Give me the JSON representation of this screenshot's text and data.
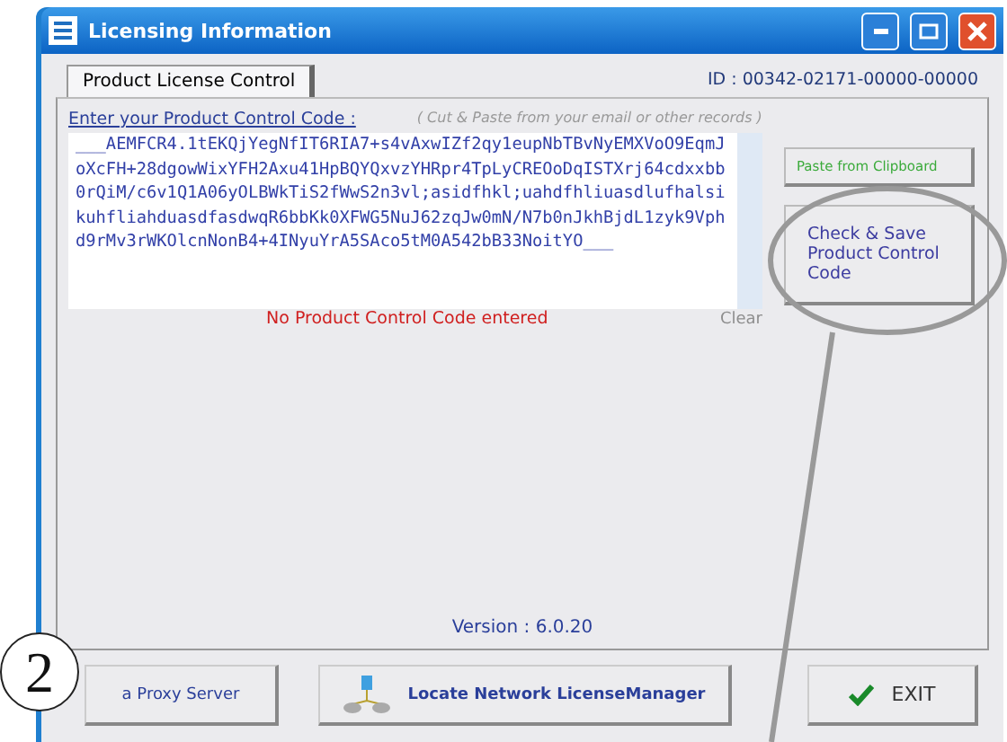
{
  "window": {
    "title": "Licensing Information"
  },
  "tabs": [
    {
      "label": "Product License Control",
      "selected": true
    }
  ],
  "id_label": "ID : 00342-02171-00000-00000",
  "code_label": "Enter your Product Control Code :",
  "code_hint": "( Cut & Paste from your email or other records )",
  "code_value": "___AEMFCR4.1tEKQjYegNfIT6RIA7+s4vAxwIZf2qy1eupNbTBvNyEMXVoO9EqmJoXcFH+28dgowWixYFH2Axu41HpBQYQxvzYHRpr4TpLyCREOoDqISTXrj64cdxxbb0rQiM/c6v1Q1A06yOLBWkTiS2fWwS2n3vl;asidfhkl;uahdfhliuasdlufhalsikuhfliahduasdfasdwqR6bbKk0XFWG5NuJ62zqJw0mN/N7b0nJkhBjdL1zyk9Vphd9rMv3rWKOlcnNonB4+4INyuYrA5SAco5tM0A542bB33NoitYO___",
  "status_message": "No Product Control Code entered",
  "clear_label": "Clear",
  "side_buttons": [
    {
      "label": "Paste from Clipboard",
      "kind": "paste"
    },
    {
      "label": "Check & Save Product Control Code",
      "kind": "check"
    }
  ],
  "version": "Version : 6.0.20",
  "bottom_buttons": [
    {
      "label": "a Proxy Server",
      "kind": "proxy"
    },
    {
      "label": "Locate Network LicenseManager",
      "kind": "network"
    },
    {
      "label": "EXIT",
      "kind": "exit"
    }
  ],
  "callout": "2"
}
